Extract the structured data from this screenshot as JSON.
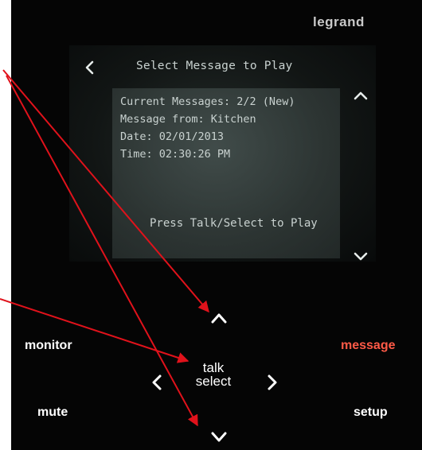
{
  "device": {
    "brand": "legrand"
  },
  "screen": {
    "title": "Select Message to Play",
    "back_icon": "chevron-left-icon",
    "scroll_up_icon": "chevron-up-icon",
    "scroll_down_icon": "chevron-down-icon",
    "message": {
      "current_messages": "Current Messages: 2/2 (New)",
      "from": "Message from: Kitchen",
      "date": "Date: 02/01/2013",
      "time": "Time: 02:30:26 PM",
      "instruction": "Press Talk/Select to Play"
    }
  },
  "controls": {
    "monitor_label": "monitor",
    "message_label": "message",
    "mute_label": "mute",
    "setup_label": "setup",
    "talk_label": "talk",
    "select_label": "select",
    "up_icon": "chevron-up-icon",
    "down_icon": "chevron-down-icon",
    "left_icon": "chevron-left-icon",
    "right_icon": "chevron-right-icon"
  },
  "colors": {
    "panel_background": "#050505",
    "screen_text": "#c9d2d0",
    "button_text": "#ffffff",
    "message_accent": "#ff5a47",
    "annotation_arrow": "#e0121b",
    "brand_text": "#c9c9c9"
  }
}
